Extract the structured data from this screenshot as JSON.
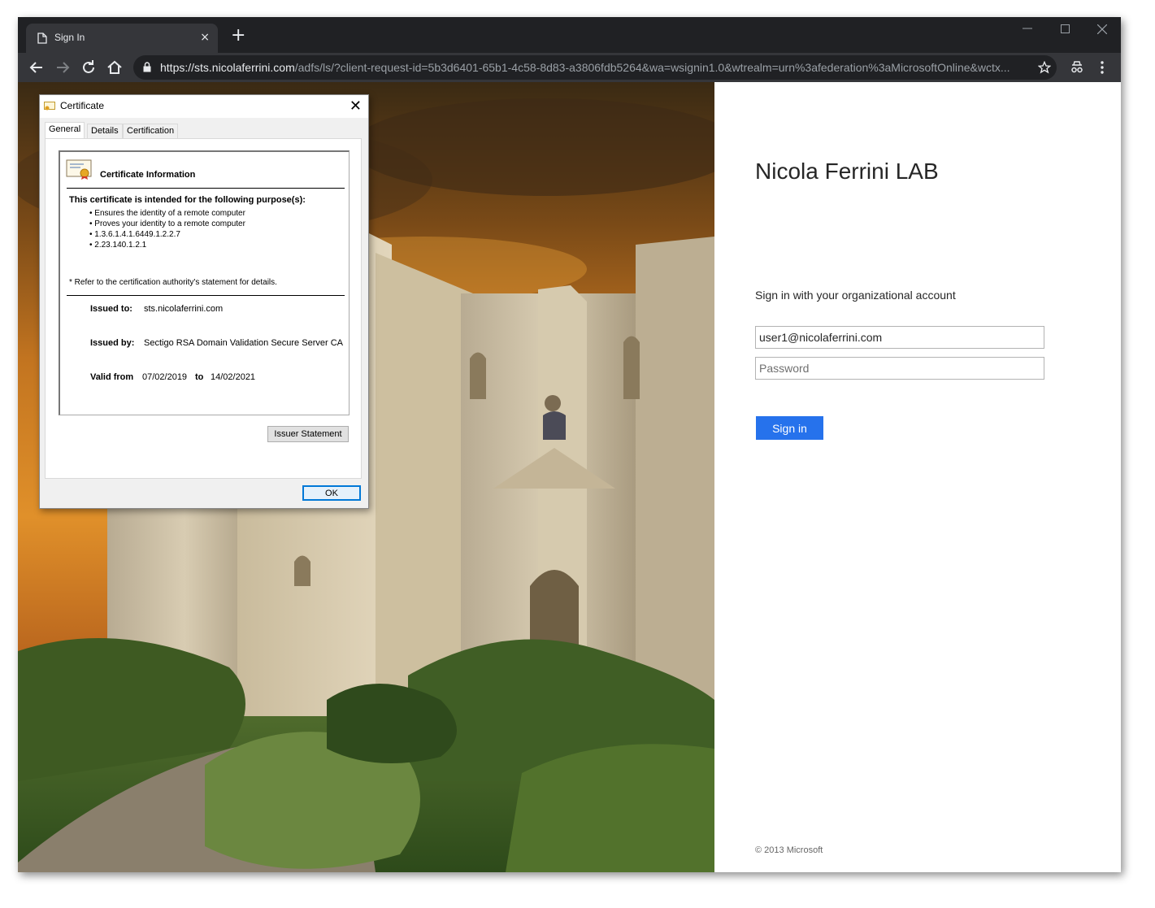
{
  "browser": {
    "tab_title": "Sign In",
    "tab_close": "×",
    "new_tab": "+",
    "url_scheme": "https://",
    "url_host": "sts.nicolaferrini.com",
    "url_rest": "/adfs/ls/?client-request-id=5b3d6401-65b1-4c58-8d83-a3806fdb5264&wa=wsignin1.0&wtrealm=urn%3afederation%3aMicrosoftOnline&wctx..."
  },
  "login": {
    "org_title": "Nicola Ferrini LAB",
    "hint": "Sign in with your organizational account",
    "username_value": "user1@nicolaferrini.com",
    "password_placeholder": "Password",
    "signin_label": "Sign in",
    "copyright": "© 2013 Microsoft",
    "accent_color": "#2672ec"
  },
  "certificate": {
    "window_title": "Certificate",
    "tabs": [
      "General",
      "Details",
      "Certification Path"
    ],
    "info_title": "Certificate Information",
    "purpose_heading": "This certificate is intended for the following purpose(s):",
    "purposes": [
      "• Ensures the identity of a remote computer",
      "• Proves your identity to a remote computer",
      "• 1.3.6.1.4.1.6449.1.2.2.7",
      "• 2.23.140.1.2.1"
    ],
    "refer_note": "* Refer to the certification authority's statement for details.",
    "issued_to_label": "Issued to:",
    "issued_to": "sts.nicolaferrini.com",
    "issued_by_label": "Issued by:",
    "issued_by": "Sectigo RSA Domain Validation Secure Server CA",
    "valid_from_label": "Valid from",
    "valid_from": "07/02/2019",
    "to_label": "to",
    "valid_to": "14/02/2021",
    "issuer_statement_label": "Issuer Statement",
    "ok_label": "OK"
  }
}
